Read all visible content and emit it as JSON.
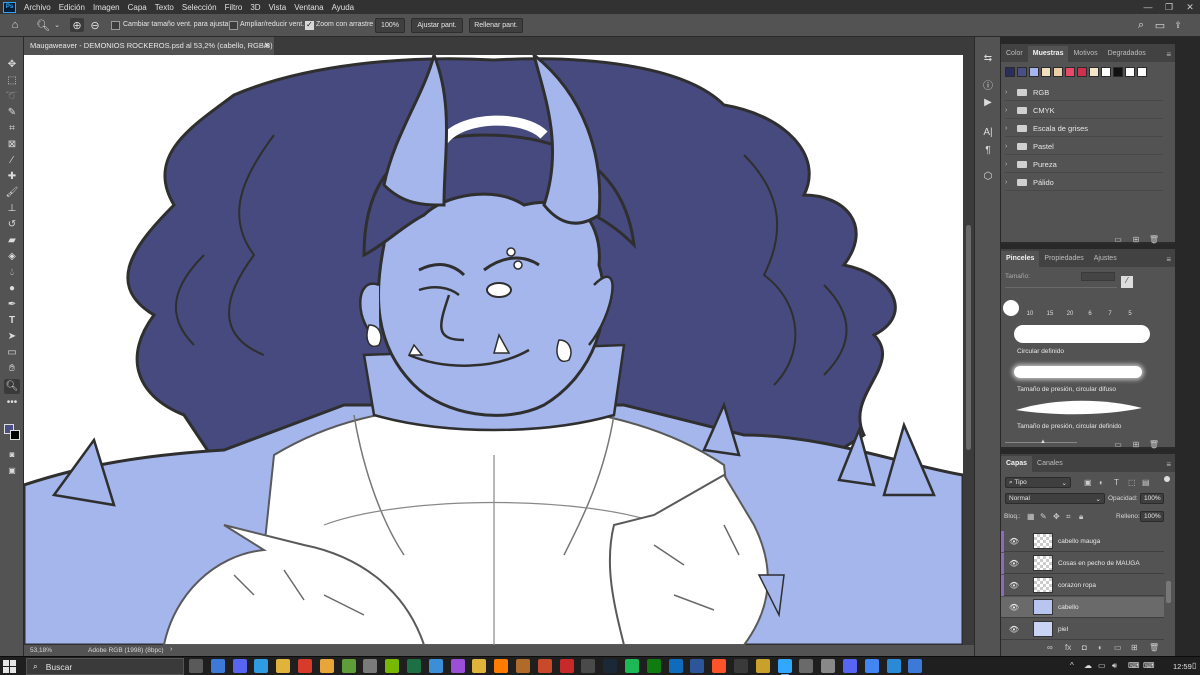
{
  "app": {
    "logo_text": "Ps",
    "menu": [
      "Archivo",
      "Edición",
      "Imagen",
      "Capa",
      "Texto",
      "Selección",
      "Filtro",
      "3D",
      "Vista",
      "Ventana",
      "Ayuda"
    ]
  },
  "options_bar": {
    "resize_windows_label": "Cambiar tamaño vent. para ajustar",
    "zoom_all_windows_label": "Ampliar/reducir vent.",
    "scrubby_zoom_label": "Zoom con arrastre",
    "zoom_100_label": "100%",
    "fit_screen_label": "Ajustar pant.",
    "fill_screen_label": "Rellenar pant.",
    "resize_windows_checked": false,
    "zoom_all_windows_checked": false,
    "scrubby_zoom_checked": true
  },
  "document": {
    "tab_title": "Maugaweaver - DEMONIOS ROCKEROS.psd al 53,2% (cabello, RGB/8) *",
    "zoom_status": "53,18%",
    "color_profile": "Adobe RGB (1998) (8bpc)"
  },
  "colors": {
    "foreground": "#4a4e82",
    "background": "#000000",
    "hair": "#474a7e",
    "skin": "#a4b6ec",
    "skin_shadow": "#8ea2de",
    "lineart": "#2f2f2f",
    "sketch": "#5a5a5a"
  },
  "swatches_panel": {
    "tabs": [
      "Color",
      "Muestras",
      "Motivos",
      "Degradados"
    ],
    "active_tab": "Muestras",
    "recent_swatches": [
      "#2b2d5a",
      "#4a4e82",
      "#a4b6ec",
      "#f0e0c0",
      "#e8cfa8",
      "#e84a6a",
      "#d03050",
      "#f5e6c8",
      "#ffffff",
      "#111111",
      "#ffffff",
      "#ffffff"
    ],
    "folders": [
      "RGB",
      "CMYK",
      "Escala de grises",
      "Pastel",
      "Pureza",
      "Pálido"
    ]
  },
  "brushes_panel": {
    "tabs": [
      "Pinceles",
      "Propiedades",
      "Ajustes"
    ],
    "active_tab": "Pinceles",
    "size_label": "Tamaño:",
    "tip_sizes": [
      "10",
      "15",
      "20",
      "6",
      "7",
      "5"
    ],
    "brushes": [
      "Circular definido",
      "Tamaño de presión, circular difuso",
      "Tamaño de presión, circular definido"
    ]
  },
  "layers_panel": {
    "tabs": [
      "Capas",
      "Canales"
    ],
    "active_tab": "Capas",
    "filter_kind": "Tipo",
    "blend_mode": "Normal",
    "opacity_label": "Opacidad:",
    "opacity_value": "100%",
    "lock_label": "Bloq.:",
    "fill_label": "Relleno:",
    "fill_value": "100%",
    "layers": [
      {
        "name": "cabello mauga",
        "clipped": true,
        "selected": false
      },
      {
        "name": "Cosas en pecho de MAUGA",
        "clipped": true,
        "selected": false
      },
      {
        "name": "corazon ropa",
        "clipped": true,
        "selected": false
      },
      {
        "name": "cabello",
        "clipped": false,
        "selected": true
      },
      {
        "name": "piel",
        "clipped": false,
        "selected": false
      }
    ]
  },
  "taskbar": {
    "search_text": "Buscar",
    "clock": "12:59",
    "pinned_apps": [
      "task-view",
      "widgets",
      "discord",
      "edge",
      "explorer",
      "pdf-reader",
      "chrome",
      "minecraft",
      "cpu-monitor",
      "nvidia",
      "excel",
      "file-manager",
      "premiere",
      "files",
      "illustrator",
      "game",
      "tool",
      "exec",
      "calc",
      "steam",
      "spotify",
      "xbox",
      "outlook",
      "word",
      "brave",
      "terminal",
      "media",
      "photoshop",
      "notes",
      "camera",
      "discord-alt",
      "chrome-alt",
      "gallery",
      "edge-alt"
    ]
  }
}
